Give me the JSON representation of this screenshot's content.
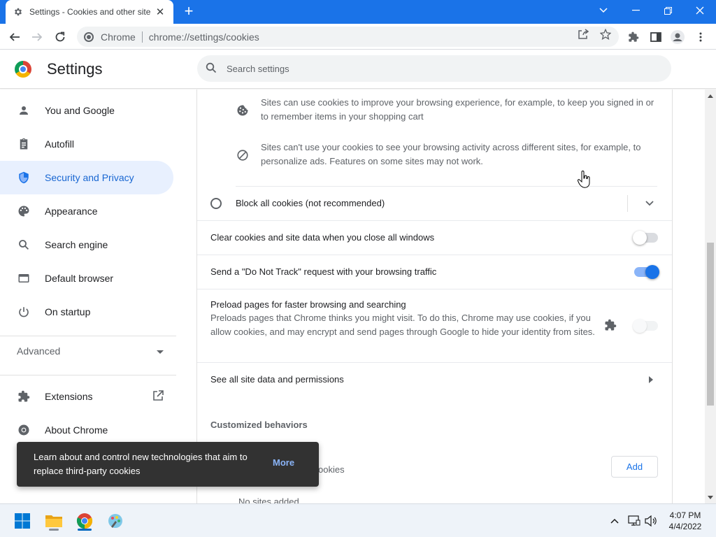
{
  "browser": {
    "tab_title": "Settings - Cookies and other site",
    "new_tab_label": "+",
    "omnibox_site_label": "Chrome",
    "omnibox_url": "chrome://settings/cookies"
  },
  "settings_header": {
    "title": "Settings",
    "search_placeholder": "Search settings"
  },
  "sidebar": {
    "items": [
      {
        "label": "You and Google",
        "icon": "person-icon"
      },
      {
        "label": "Autofill",
        "icon": "clipboard-icon"
      },
      {
        "label": "Security and Privacy",
        "icon": "shield-icon",
        "active": true
      },
      {
        "label": "Appearance",
        "icon": "palette-icon"
      },
      {
        "label": "Search engine",
        "icon": "search-icon"
      },
      {
        "label": "Default browser",
        "icon": "browser-window-icon"
      },
      {
        "label": "On startup",
        "icon": "power-icon"
      }
    ],
    "advanced_label": "Advanced",
    "extensions_label": "Extensions",
    "about_label": "About Chrome"
  },
  "main": {
    "bullet_1": "Sites can use cookies to improve your browsing experience, for example, to keep you signed in or to remember items in your shopping cart",
    "bullet_2": "Sites can't use your cookies to see your browsing activity across different sites, for example, to personalize ads. Features on some sites may not work.",
    "block_all_label": "Block all cookies (not recommended)",
    "clear_on_close_label": "Clear cookies and site data when you close all windows",
    "clear_on_close_enabled": false,
    "do_not_track_label": "Send a \"Do Not Track\" request with your browsing traffic",
    "do_not_track_enabled": true,
    "preload_label": "Preload pages for faster browsing and searching",
    "preload_description": "Preloads pages that Chrome thinks you might visit. To do this, Chrome may use cookies, if you allow cookies, and may encrypt and send pages through Google to hide your identity from sites.",
    "preload_enabled": false,
    "see_all_label": "See all site data and permissions",
    "customized_behaviors_title": "Customized behaviors",
    "partial_row_label": "ookies",
    "add_button_label": "Add",
    "no_sites_label": "No sites added"
  },
  "toast": {
    "message": "Learn about and control new technologies that aim to replace third-party cookies",
    "action_label": "More"
  },
  "taskbar": {
    "time": "4:07 PM",
    "date": "4/4/2022"
  },
  "colors": {
    "accent": "#1a73e8",
    "active_nav_bg": "#e8f0fe",
    "toast_bg": "#323232"
  }
}
